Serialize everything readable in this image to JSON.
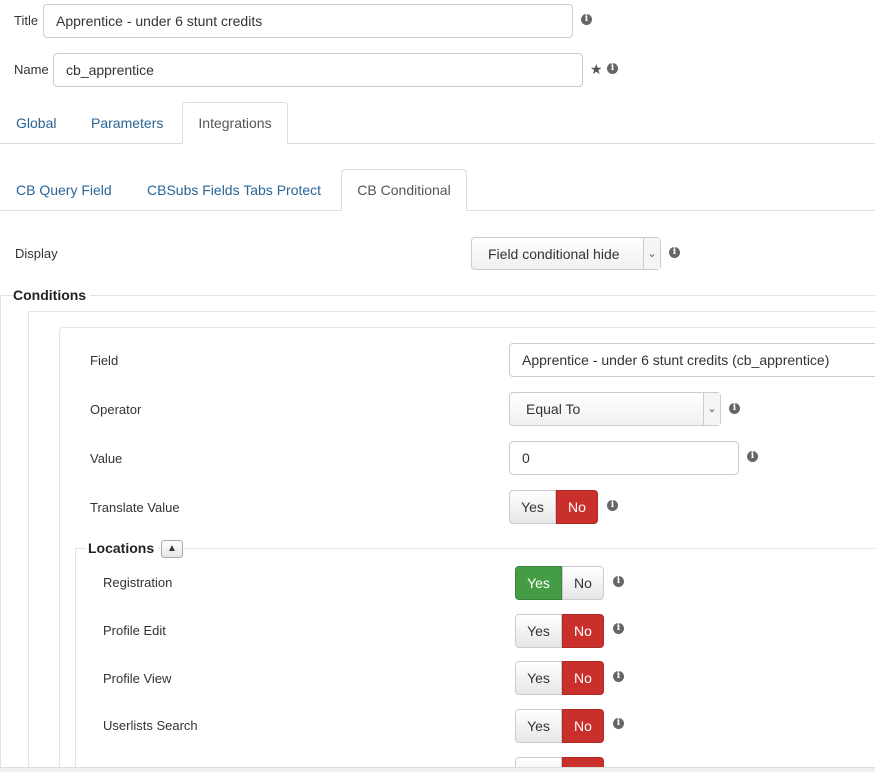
{
  "form": {
    "title_label": "Title",
    "title_value": "Apprentice - under 6 stunt credits",
    "name_label": "Name",
    "name_value": "cb_apprentice"
  },
  "tabs_main": [
    {
      "label": "Global"
    },
    {
      "label": "Parameters"
    },
    {
      "label": "Integrations"
    }
  ],
  "tabs_sub": [
    {
      "label": "CB Query Field"
    },
    {
      "label": "CBSubs Fields Tabs Protect"
    },
    {
      "label": "CB Conditional"
    }
  ],
  "display": {
    "label": "Display",
    "selected": "Field conditional hide"
  },
  "conditions": {
    "title": "Conditions",
    "field_label": "Field",
    "field_value": "Apprentice - under 6 stunt credits (cb_apprentice)",
    "operator_label": "Operator",
    "operator_value": "Equal To",
    "value_label": "Value",
    "value_value": "0",
    "translate_label": "Translate Value"
  },
  "locations": {
    "title": "Locations",
    "items": [
      {
        "label": "Registration",
        "value": "Yes"
      },
      {
        "label": "Profile Edit",
        "value": "No"
      },
      {
        "label": "Profile View",
        "value": "No"
      },
      {
        "label": "Userlists Search",
        "value": "No"
      }
    ]
  },
  "toggle": {
    "yes": "Yes",
    "no": "No",
    "translate_value": "No"
  },
  "colors": {
    "link": "#2a6496",
    "danger": "#c9302c",
    "success": "#449d44"
  }
}
